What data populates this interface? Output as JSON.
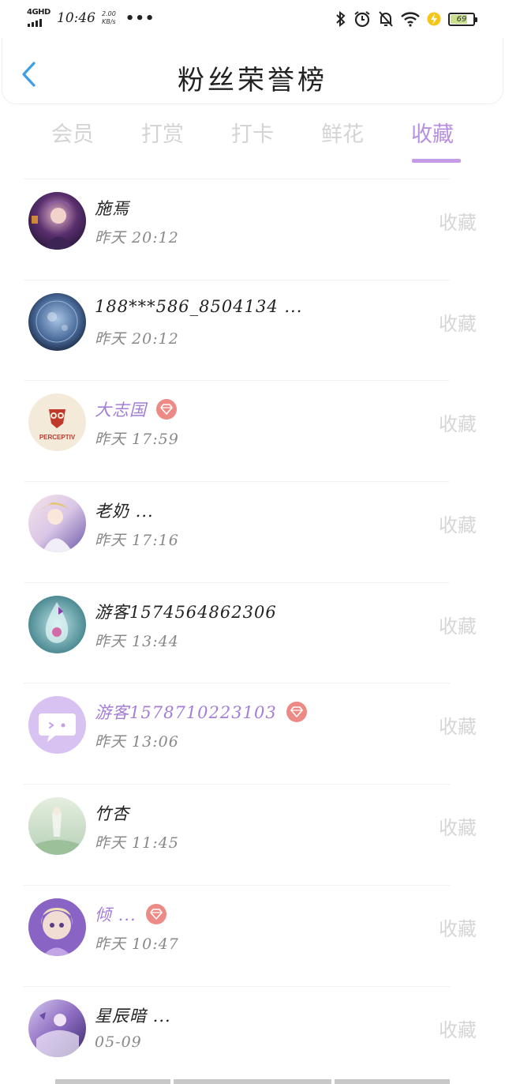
{
  "status_bar": {
    "network": "4GHD",
    "time": "10:46",
    "speed_value": "2.00",
    "speed_unit": "KB/s",
    "more": "•••",
    "battery": "69",
    "icons": [
      "bluetooth-icon",
      "alarm-icon",
      "mute-icon",
      "wifi-icon",
      "charging-icon",
      "battery-icon"
    ]
  },
  "header": {
    "title": "粉丝荣誉榜",
    "back_icon": "chevron-left-icon"
  },
  "tabs": [
    {
      "label": "会员",
      "active": false
    },
    {
      "label": "打赏",
      "active": false
    },
    {
      "label": "打卡",
      "active": false
    },
    {
      "label": "鲜花",
      "active": false
    },
    {
      "label": "收藏",
      "active": true
    }
  ],
  "colors": {
    "accent": "#b88fe0",
    "vip_name": "#a47ed6",
    "gem_badge": "#ee8a86",
    "back_arrow": "#3a9ee8",
    "inactive": "#d4d4d4"
  },
  "fans": [
    {
      "name": "施焉",
      "time": "昨天 20:12",
      "action": "收藏",
      "vip": false,
      "avatar": "avatar-anime-warrior"
    },
    {
      "name": "188***586_8504134 ...",
      "time": "昨天 20:12",
      "action": "收藏",
      "vip": false,
      "avatar": "avatar-blue-orb"
    },
    {
      "name": "大志国",
      "time": "昨天 17:59",
      "action": "收藏",
      "vip": true,
      "avatar": "avatar-perceptiv-logo",
      "avatar_text": "PERCEPTIV"
    },
    {
      "name": "老奶 ...",
      "time": "昨天 17:16",
      "action": "收藏",
      "vip": false,
      "avatar": "avatar-anime-girl"
    },
    {
      "name": "游客1574564862306",
      "time": "昨天 13:44",
      "action": "收藏",
      "vip": false,
      "avatar": "avatar-water-drop"
    },
    {
      "name": "游客1578710223103",
      "time": "昨天 13:06",
      "action": "收藏",
      "vip": true,
      "avatar": "avatar-chat-bubble"
    },
    {
      "name": "竹杏",
      "time": "昨天 11:45",
      "action": "收藏",
      "vip": false,
      "avatar": "avatar-green-scene"
    },
    {
      "name": "倾 ...",
      "time": "昨天 10:47",
      "action": "收藏",
      "vip": true,
      "avatar": "avatar-doll-girl"
    },
    {
      "name": "星辰暗 ...",
      "time": "05-09",
      "action": "收藏",
      "vip": false,
      "avatar": "avatar-purple-art"
    }
  ]
}
